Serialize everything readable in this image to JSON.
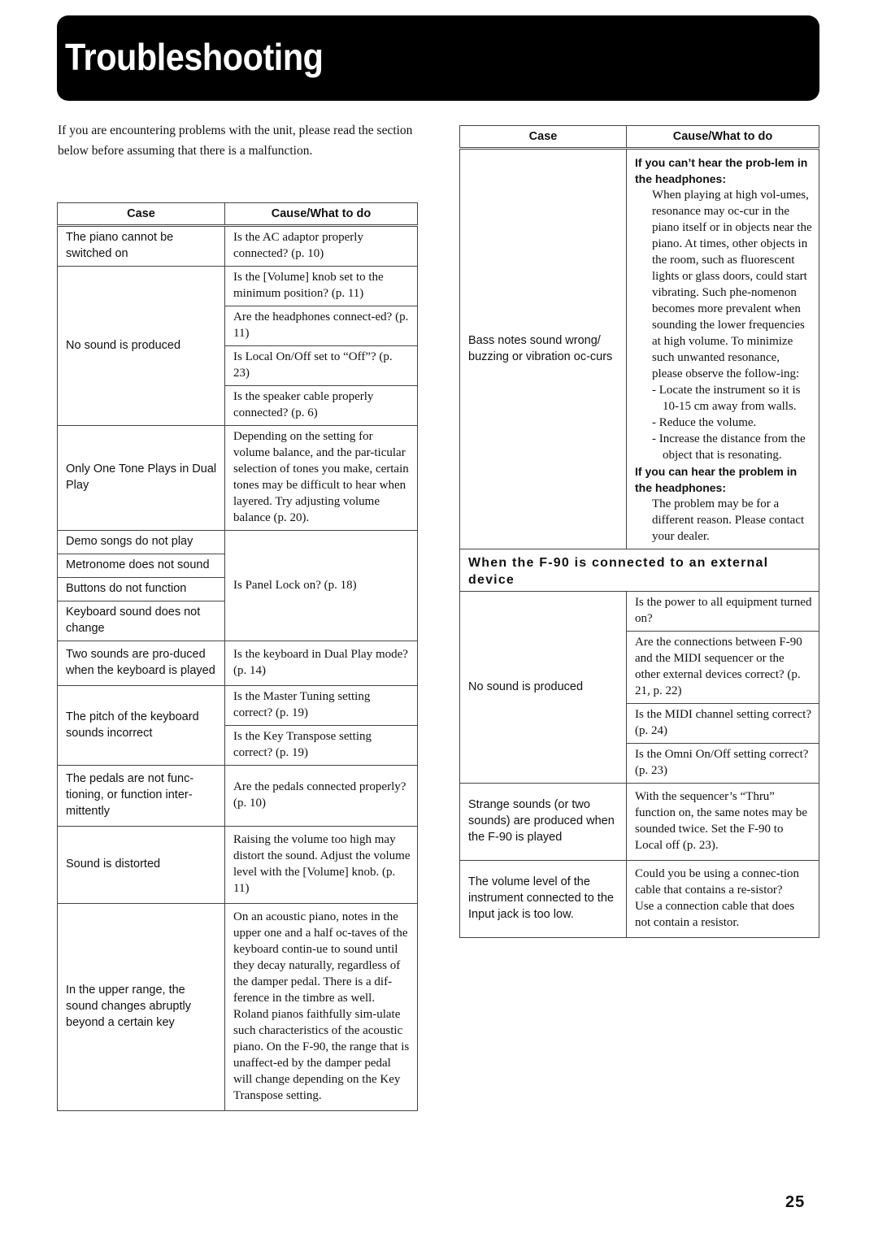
{
  "header": {
    "title": "Troubleshooting"
  },
  "intro": "If you are encountering problems with the unit, please read the section below before assuming that there is a malfunction.",
  "table_headers": {
    "case": "Case",
    "cause": "Cause/What to do"
  },
  "left_table": {
    "r1": {
      "case": "The piano cannot be switched on",
      "cause": "Is the AC adaptor properly connected? (p. 10)"
    },
    "r2": {
      "case": "No sound is produced",
      "causes": [
        "Is the [Volume] knob set to the minimum position? (p. 11)",
        "Are the headphones connect-ed? (p. 11)",
        "Is Local On/Off set to “Off”? (p. 23)",
        "Is the speaker cable properly connected? (p. 6)"
      ]
    },
    "r3": {
      "case": "Only One Tone Plays in Dual Play",
      "cause": "Depending on the setting for volume balance, and the par-ticular selection of tones you make, certain tones may be difficult to hear when layered. Try adjusting volume balance (p. 20)."
    },
    "r4": {
      "cases": [
        "Demo songs do not play",
        "Metronome does not sound",
        "Buttons do not function",
        "Keyboard sound does not change"
      ],
      "cause": "Is Panel Lock on? (p. 18)"
    },
    "r5": {
      "case": "Two sounds are pro-duced when the keyboard is played",
      "cause": "Is the keyboard in Dual Play mode? (p. 14)"
    },
    "r6": {
      "case": "The pitch of the keyboard sounds incorrect",
      "causes": [
        "Is the Master Tuning setting correct? (p. 19)",
        "Is the Key Transpose setting correct? (p. 19)"
      ]
    },
    "r7": {
      "case": "The pedals are not func-tioning, or function inter-mittently",
      "cause": "Are the pedals connected properly? (p. 10)"
    },
    "r8": {
      "case": "Sound is distorted",
      "cause": "Raising the volume too high may distort the sound. Adjust the volume level with the [Volume] knob. (p. 11)"
    },
    "r9": {
      "case": "In the upper range, the sound changes abruptly beyond a certain key",
      "cause": "On an acoustic piano, notes in the upper one and a half oc-taves of the keyboard contin-ue to sound until they decay naturally, regardless of the damper pedal. There is a dif-ference in the timbre as well. Roland pianos faithfully sim-ulate such characteristics of the acoustic piano. On the F-90, the range that is unaffect-ed by the damper pedal will change depending on the Key Transpose setting."
    }
  },
  "right_table": {
    "bass": {
      "case": "Bass notes sound wrong/ buzzing or vibration oc-curs",
      "heading1": "If you can’t hear the prob-lem in the headphones:",
      "text1": "When playing at high vol-umes, resonance may oc-cur in the piano itself or in objects near the piano. At times, other objects in the room, such as fluorescent lights or glass doors, could start vibrating. Such phe-nomenon becomes more prevalent when sounding the lower frequencies at high volume. To minimize such unwanted resonance, please observe the follow-ing:",
      "bullets": [
        "- Locate the instrument so it is 10-15 cm away from walls.",
        "- Reduce the volume.",
        "- Increase the distance from the object that is resonating."
      ],
      "heading2": "If you can hear the problem in the headphones:",
      "text2": "The problem may be for a different reason. Please contact your dealer."
    },
    "section_title": "When the F-90 is connected to an external device",
    "ext1": {
      "case": "No sound is produced",
      "causes": [
        "Is the power to all equipment turned on?",
        "Are the connections between F-90 and the MIDI sequencer or the other external devices correct? (p. 21, p. 22)",
        "Is the MIDI channel setting correct? (p. 24)",
        "Is the Omni On/Off setting correct? (p. 23)"
      ]
    },
    "ext2": {
      "case": "Strange sounds (or two sounds) are produced when the F-90 is played",
      "cause": "With the sequencer’s “Thru” function on, the same notes may be sounded twice. Set the F-90 to Local off (p. 23)."
    },
    "ext3": {
      "case": "The volume level of the instrument connected to the Input jack is too low.",
      "cause1": "Could you be using a connec-tion cable that contains a re-sistor?",
      "cause2": "Use a connection cable that does not contain a resistor."
    }
  },
  "page_number": "25"
}
